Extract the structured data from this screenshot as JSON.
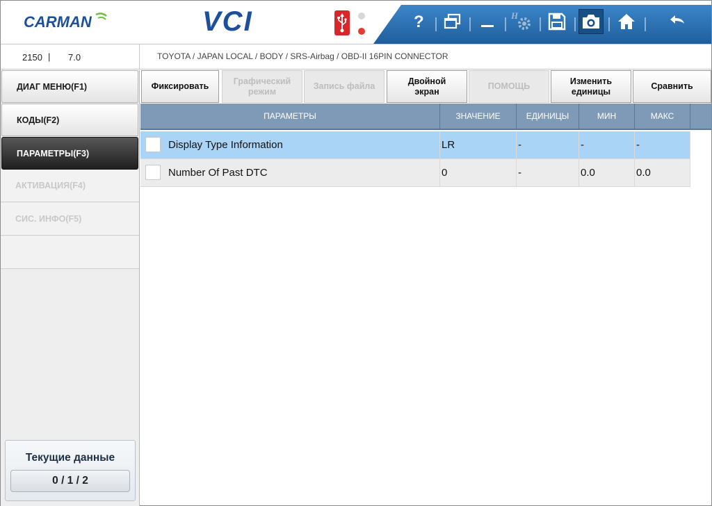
{
  "header": {
    "brand": "CARMAN",
    "app_title": "VCI",
    "toolbar": [
      {
        "name": "help-icon",
        "glyph": "?"
      },
      {
        "name": "windows-icon",
        "glyph": "⧉"
      },
      {
        "name": "minimize-icon",
        "glyph": "▁"
      },
      {
        "name": "settings-icon",
        "glyph": "⚙"
      },
      {
        "name": "save-icon",
        "glyph": "💾"
      },
      {
        "name": "camera-icon",
        "glyph": "📷"
      },
      {
        "name": "home-icon",
        "glyph": "⌂"
      },
      {
        "name": "back-icon",
        "glyph": "↶"
      }
    ],
    "usb_status": "connected"
  },
  "infobar": {
    "version_a": "2150",
    "separator": "|",
    "version_b": "7.0",
    "breadcrumb": "TOYOTA / JAPAN LOCAL / BODY / SRS-Airbag / OBD-II 16PIN CONNECTOR"
  },
  "sidebar": {
    "items": [
      {
        "label": "ДИАГ МЕНЮ(F1)",
        "state": "enabled"
      },
      {
        "label": "КОДЫ(F2)",
        "state": "enabled"
      },
      {
        "label": "ПАРАМЕТРЫ(F3)",
        "state": "active"
      },
      {
        "label": "АКТИВАЦИЯ(F4)",
        "state": "disabled"
      },
      {
        "label": "СИС. ИНФО(F5)",
        "state": "disabled"
      },
      {
        "label": "",
        "state": "disabled"
      }
    ],
    "current_title": "Текущие данные",
    "current_count": "0 / 1 / 2"
  },
  "function_bar": {
    "buttons": [
      {
        "label": "Фиксировать",
        "enabled": true
      },
      {
        "label": "Графический\nрежим",
        "enabled": false
      },
      {
        "label": "Запись файла",
        "enabled": false
      },
      {
        "label": "Двойной\nэкран",
        "enabled": true
      },
      {
        "label": "ПОМОЩЬ",
        "enabled": false
      },
      {
        "label": "Изменить\nединицы",
        "enabled": true
      },
      {
        "label": "Сравнить",
        "enabled": true
      }
    ]
  },
  "table": {
    "headers": [
      "ПАРАМЕТРЫ",
      "ЗНАЧЕНИЕ",
      "ЕДИНИЦЫ",
      "МИН",
      "МАКС"
    ],
    "rows": [
      {
        "name": "Display Type Information",
        "value": "LR",
        "unit": "-",
        "min": "-",
        "max": "-",
        "selected": true
      },
      {
        "name": "Number Of Past DTC",
        "value": "0",
        "unit": "-",
        "min": "0.0",
        "max": "0.0",
        "selected": false
      }
    ]
  },
  "colors": {
    "brand_blue": "#1d4f9c",
    "toolbar_blue": "#2a6fb3",
    "table_header": "#7f9ab6",
    "row_selected": "#a9d4f5"
  }
}
